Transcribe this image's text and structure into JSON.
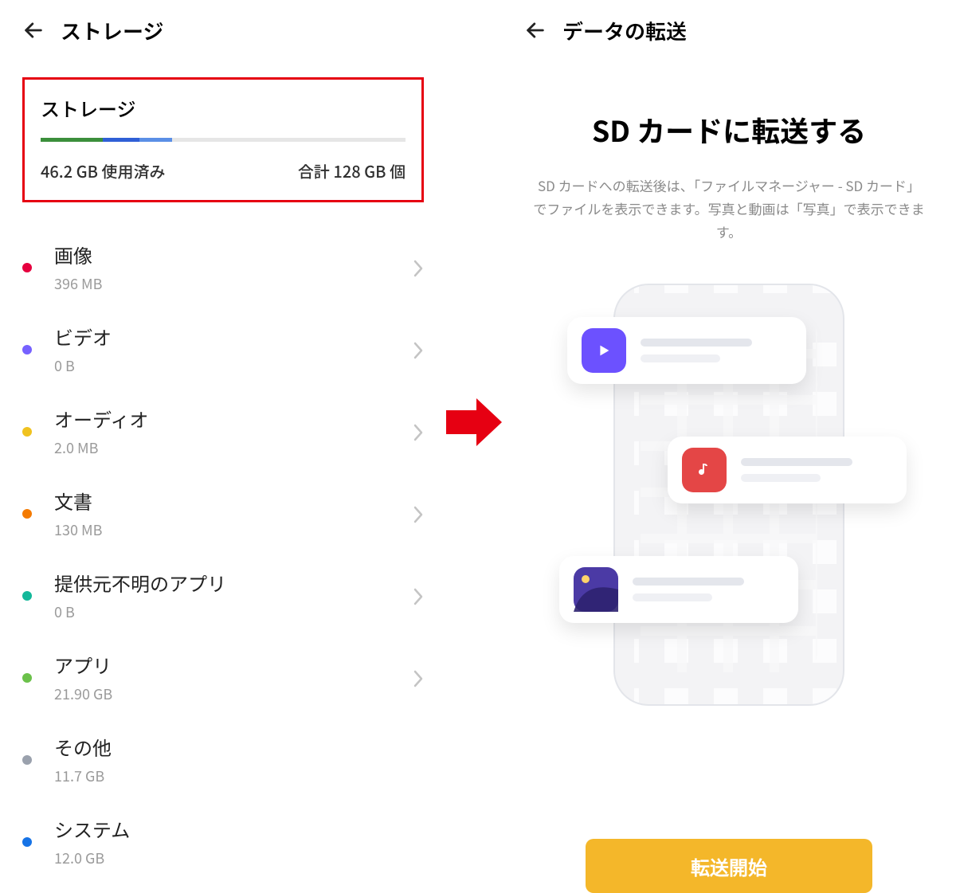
{
  "left": {
    "header_title": "ストレージ",
    "summary": {
      "title": "ストレージ",
      "used": "46.2 GB 使用済み",
      "total": "合計 128 GB 個"
    },
    "categories": [
      {
        "label": "画像",
        "size": "396 MB",
        "color": "#e6003e",
        "has_chevron": true
      },
      {
        "label": "ビデオ",
        "size": "0 B",
        "color": "#7661ff",
        "has_chevron": true
      },
      {
        "label": "オーディオ",
        "size": "2.0 MB",
        "color": "#f0c21f",
        "has_chevron": true
      },
      {
        "label": "文書",
        "size": "130 MB",
        "color": "#f47a00",
        "has_chevron": true
      },
      {
        "label": "提供元不明のアプリ",
        "size": "0 B",
        "color": "#13b89a",
        "has_chevron": true
      },
      {
        "label": "アプリ",
        "size": "21.90 GB",
        "color": "#6bc14a",
        "has_chevron": true
      },
      {
        "label": "その他",
        "size": "11.7 GB",
        "color": "#9aa1ad",
        "has_chevron": false
      },
      {
        "label": "システム",
        "size": "12.0 GB",
        "color": "#1673e6",
        "has_chevron": false
      }
    ]
  },
  "right": {
    "header_title": "データの転送",
    "title": "SD カードに転送する",
    "description": "SD カードへの転送後は、「ファイルマネージャー - SD カード」でファイルを表示できます。写真と動画は「写真」で表示できます。",
    "button": "転送開始"
  }
}
